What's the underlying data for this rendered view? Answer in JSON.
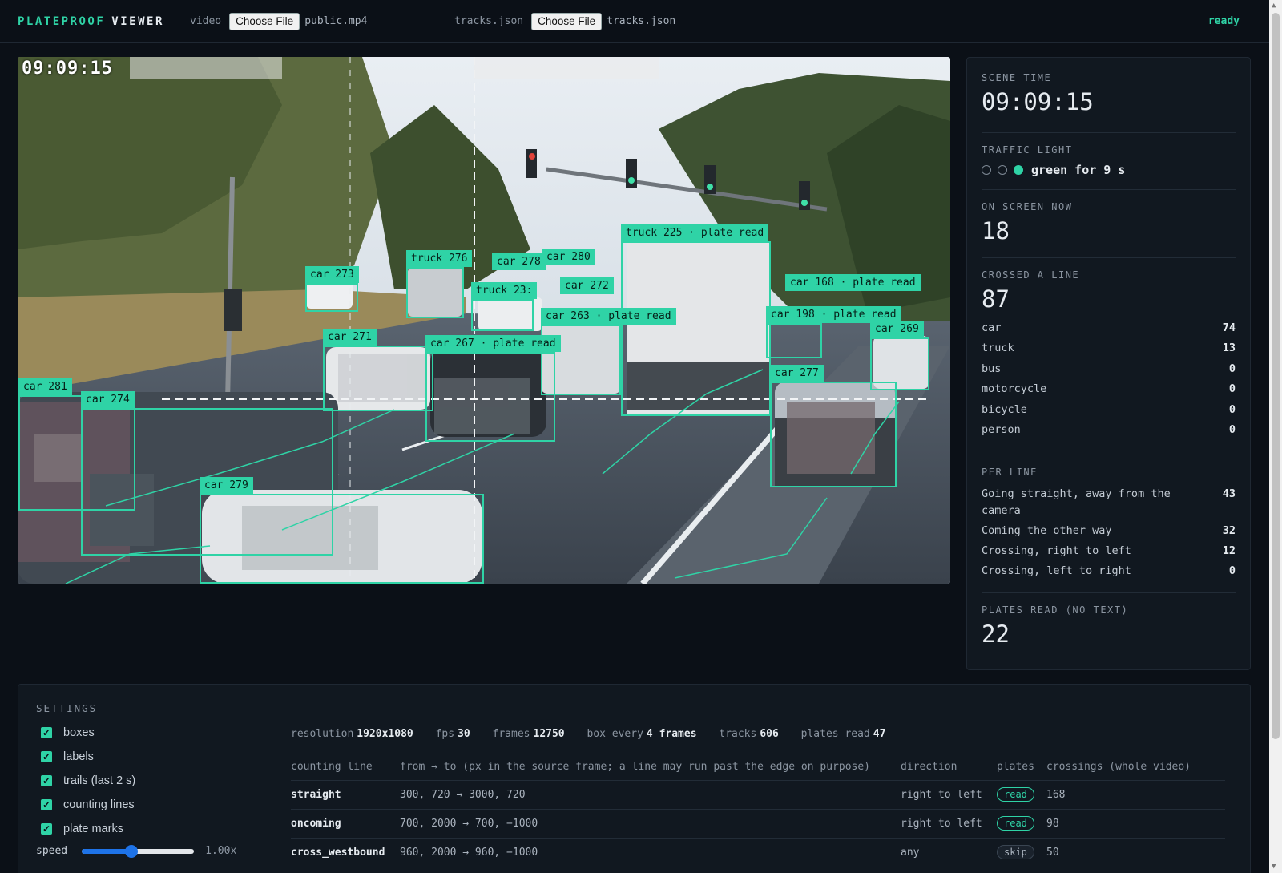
{
  "app": {
    "brand_part1": "PLATEPROOF",
    "brand_part2": "VIEWER",
    "status": "ready"
  },
  "inputs": {
    "video_label": "video",
    "video_button": "Choose File",
    "video_file": "public.mp4",
    "tracks_label": "tracks.json",
    "tracks_button": "Choose File",
    "tracks_file": "tracks.json"
  },
  "video": {
    "timestamp": "09:09:15",
    "detections": [
      {
        "label": "car 273"
      },
      {
        "label": "truck 276"
      },
      {
        "label": "car 278"
      },
      {
        "label": "car 280"
      },
      {
        "label": "truck 225 · plate read"
      },
      {
        "label": "truck 23:"
      },
      {
        "label": "car 272"
      },
      {
        "label": "car 263 · plate read"
      },
      {
        "label": "car 168 · plate read"
      },
      {
        "label": "car 198 · plate read"
      },
      {
        "label": "car 269"
      },
      {
        "label": "car 271"
      },
      {
        "label": "car 267 · plate read"
      },
      {
        "label": "car 277"
      },
      {
        "label": "car 281"
      },
      {
        "label": "car 274"
      },
      {
        "label": "car 279"
      }
    ]
  },
  "panel": {
    "scene_time_label": "SCENE TIME",
    "scene_time": "09:09:15",
    "traffic_light_label": "TRAFFIC LIGHT",
    "traffic_light_state": "green",
    "traffic_light_text": "green for 9 s",
    "on_screen_label": "ON SCREEN NOW",
    "on_screen": "18",
    "crossed_label": "CROSSED A LINE",
    "crossed": "87",
    "classes": [
      {
        "name": "car",
        "count": "74"
      },
      {
        "name": "truck",
        "count": "13"
      },
      {
        "name": "bus",
        "count": "0"
      },
      {
        "name": "motorcycle",
        "count": "0"
      },
      {
        "name": "bicycle",
        "count": "0"
      },
      {
        "name": "person",
        "count": "0"
      }
    ],
    "per_line_label": "PER LINE",
    "per_line": [
      {
        "name": "Going straight, away from the camera",
        "count": "43"
      },
      {
        "name": "Coming the other way",
        "count": "32"
      },
      {
        "name": "Crossing, right to left",
        "count": "12"
      },
      {
        "name": "Crossing, left to right",
        "count": "0"
      }
    ],
    "plates_label": "PLATES READ (NO TEXT)",
    "plates": "22"
  },
  "settings": {
    "title": "SETTINGS",
    "checkboxes": [
      {
        "label": "boxes",
        "checked": true
      },
      {
        "label": "labels",
        "checked": true
      },
      {
        "label": "trails (last 2 s)",
        "checked": true
      },
      {
        "label": "counting lines",
        "checked": true
      },
      {
        "label": "plate marks",
        "checked": true
      }
    ],
    "speed_label": "speed",
    "speed_value": "1.00x",
    "meta": {
      "resolution_label": "resolution",
      "resolution": "1920x1080",
      "fps_label": "fps",
      "fps": "30",
      "frames_label": "frames",
      "frames": "12750",
      "box_every_label": "box every",
      "box_every": "4 frames",
      "tracks_label": "tracks",
      "tracks": "606",
      "plates_label": "plates read",
      "plates": "47"
    },
    "table": {
      "headers": [
        "counting line",
        "from → to (px in the source frame; a line may run past the edge on purpose)",
        "direction",
        "plates",
        "crossings (whole video)"
      ],
      "rows": [
        {
          "name": "straight",
          "coords": "300, 720 → 3000, 720",
          "direction": "right to left",
          "plates": "read",
          "crossings": "168"
        },
        {
          "name": "oncoming",
          "coords": "700, 2000 → 700, −1000",
          "direction": "right to left",
          "plates": "read",
          "crossings": "98"
        },
        {
          "name": "cross_westbound",
          "coords": "960, 2000 → 960, −1000",
          "direction": "any",
          "plates": "skip",
          "crossings": "50"
        }
      ]
    }
  },
  "colors": {
    "accent": "#2fd3a6",
    "background": "#0b1017",
    "panel": "#111820"
  }
}
